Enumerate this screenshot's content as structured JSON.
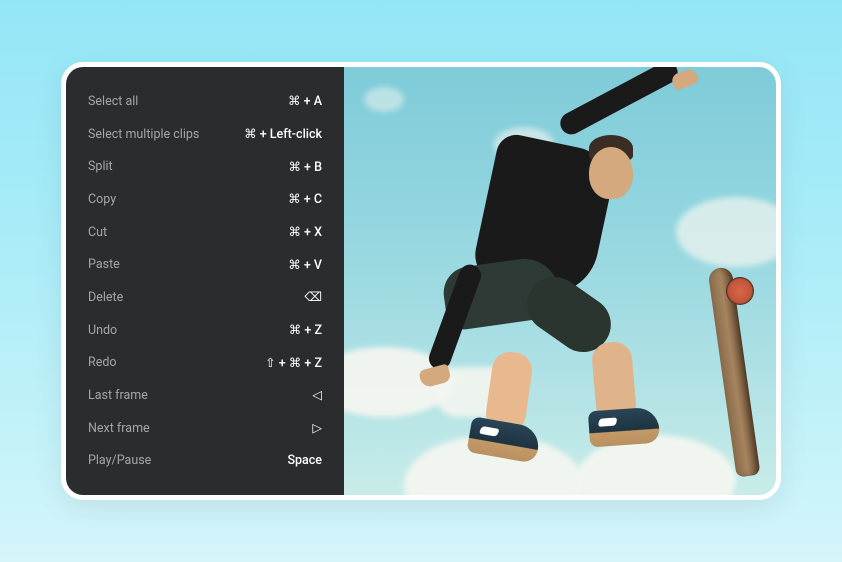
{
  "shortcuts": [
    {
      "label": "Select all",
      "keys": "⌘ + A"
    },
    {
      "label": "Select multiple clips",
      "keys": "⌘ + Left-click"
    },
    {
      "label": "Split",
      "keys": "⌘ + B"
    },
    {
      "label": "Copy",
      "keys": "⌘ + C"
    },
    {
      "label": "Cut",
      "keys": "⌘ + X"
    },
    {
      "label": "Paste",
      "keys": "⌘ + V"
    },
    {
      "label": "Delete",
      "keys": "⌫"
    },
    {
      "label": "Undo",
      "keys": "⌘ + Z"
    },
    {
      "label": "Redo",
      "keys": "⇧ + ⌘ + Z"
    },
    {
      "label": "Last frame",
      "keys": "◁"
    },
    {
      "label": "Next frame",
      "keys": "▷"
    },
    {
      "label": "Play/Pause",
      "keys": "Space"
    }
  ],
  "preview_description": "Skateboarder mid-air trick against sky with clouds"
}
